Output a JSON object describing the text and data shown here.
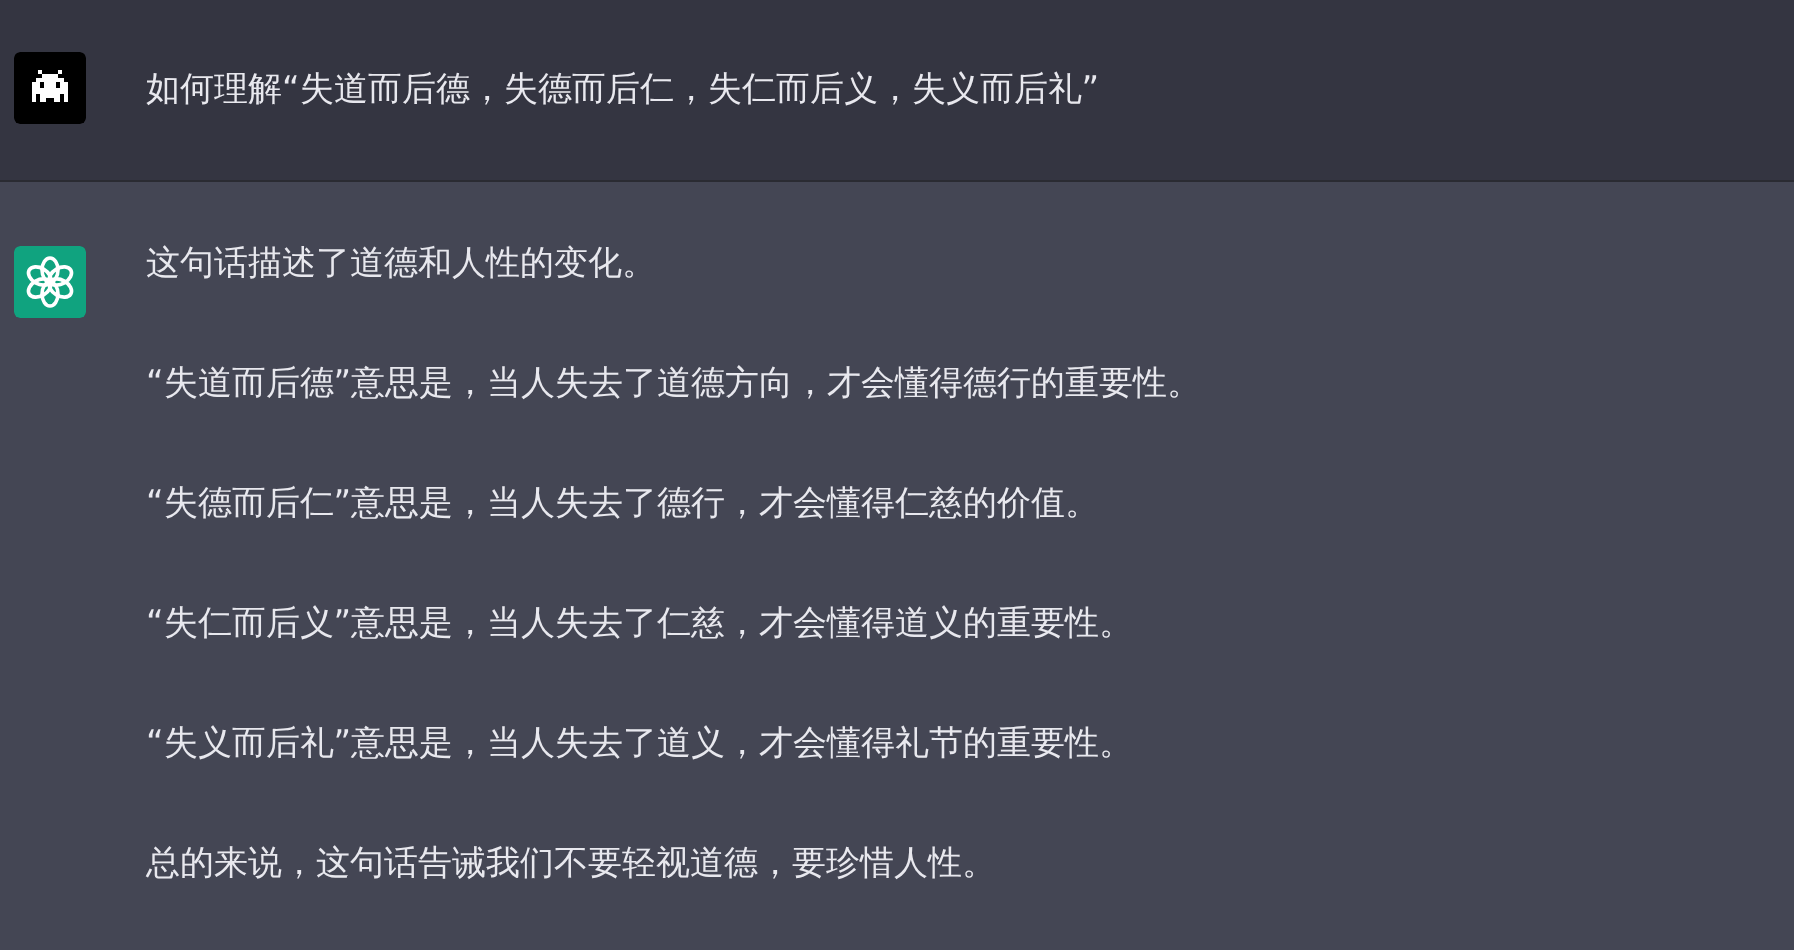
{
  "messages": [
    {
      "kind": "question",
      "paragraphs": [
        "如何理解“失道而后德，失德而后仁，失仁而后义，失义而后礼”"
      ]
    },
    {
      "kind": "answer",
      "paragraphs": [
        "这句话描述了道德和人性的变化。",
        "“失道而后德”意思是，当人失去了道德方向，才会懂得德行的重要性。",
        "“失德而后仁”意思是，当人失去了德行，才会懂得仁慈的价值。",
        "“失仁而后义”意思是，当人失去了仁慈，才会懂得道义的重要性。",
        "“失义而后礼”意思是，当人失去了道义，才会懂得礼节的重要性。",
        "总的来说，这句话告诫我们不要轻视道德，要珍惜人性。"
      ]
    }
  ]
}
